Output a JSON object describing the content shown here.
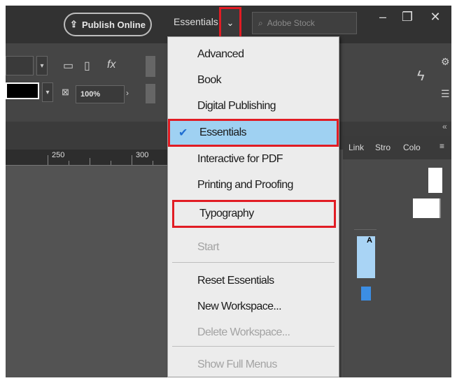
{
  "titlebar": {
    "publish_label": "Publish Online",
    "workspace_label": "Essentials",
    "search_placeholder": "Adobe Stock",
    "search_icon": "magnifier-icon",
    "window_controls": [
      "–",
      "❐",
      "✕"
    ]
  },
  "controlbar": {
    "opacity_value": "100%",
    "fx_label": "fx"
  },
  "ruler": {
    "ticks": [
      "250",
      "300"
    ]
  },
  "panel": {
    "tabs": [
      "Link",
      "Stro",
      "Colo"
    ]
  },
  "menu": {
    "items": [
      {
        "label": "Advanced",
        "state": "normal"
      },
      {
        "label": "Book",
        "state": "normal"
      },
      {
        "label": "Digital Publishing",
        "state": "normal"
      },
      {
        "label": "Essentials",
        "state": "selected"
      },
      {
        "label": "Interactive for PDF",
        "state": "normal"
      },
      {
        "label": "Printing and Proofing",
        "state": "normal"
      },
      {
        "label": "Typography",
        "state": "highlighted"
      },
      {
        "label": "Start",
        "state": "disabled"
      },
      {
        "label": "Reset Essentials",
        "state": "normal"
      },
      {
        "label": "New Workspace...",
        "state": "normal"
      },
      {
        "label": "Delete Workspace...",
        "state": "disabled"
      },
      {
        "label": "Show Full Menus",
        "state": "disabled"
      }
    ]
  },
  "colors": {
    "highlight_border": "#e11c24",
    "selected_bg": "#9fd1f2",
    "checkmark": "#1f6ed1"
  }
}
